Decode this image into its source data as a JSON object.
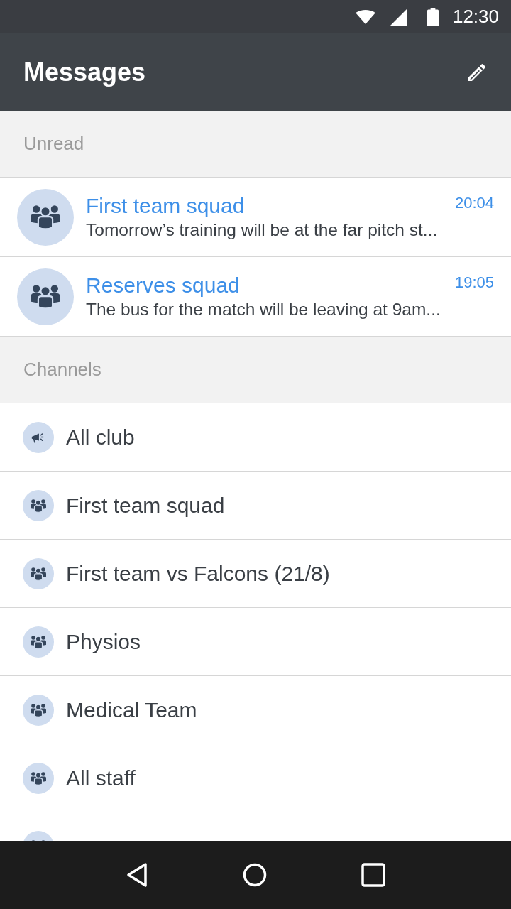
{
  "status_bar": {
    "time": "12:30"
  },
  "app_bar": {
    "title": "Messages"
  },
  "sections": [
    {
      "kind": "unread",
      "title": "Unread",
      "items": [
        {
          "kind": "group",
          "name": "First team squad",
          "time": "20:04",
          "preview": "Tomorrow’s training will be at the far pitch st..."
        },
        {
          "kind": "group",
          "name": "Reserves squad",
          "time": "19:05",
          "preview": "The bus for the match will be leaving at 9am..."
        }
      ]
    },
    {
      "kind": "channels",
      "title": "Channels",
      "items": [
        {
          "kind": "announcement",
          "name": "All club"
        },
        {
          "kind": "group",
          "name": "First team squad"
        },
        {
          "kind": "group",
          "name": "First team vs Falcons (21/8)"
        },
        {
          "kind": "group",
          "name": "Physios"
        },
        {
          "kind": "group",
          "name": "Medical Team"
        },
        {
          "kind": "group",
          "name": "All staff"
        },
        {
          "kind": "group"
        }
      ]
    }
  ]
}
